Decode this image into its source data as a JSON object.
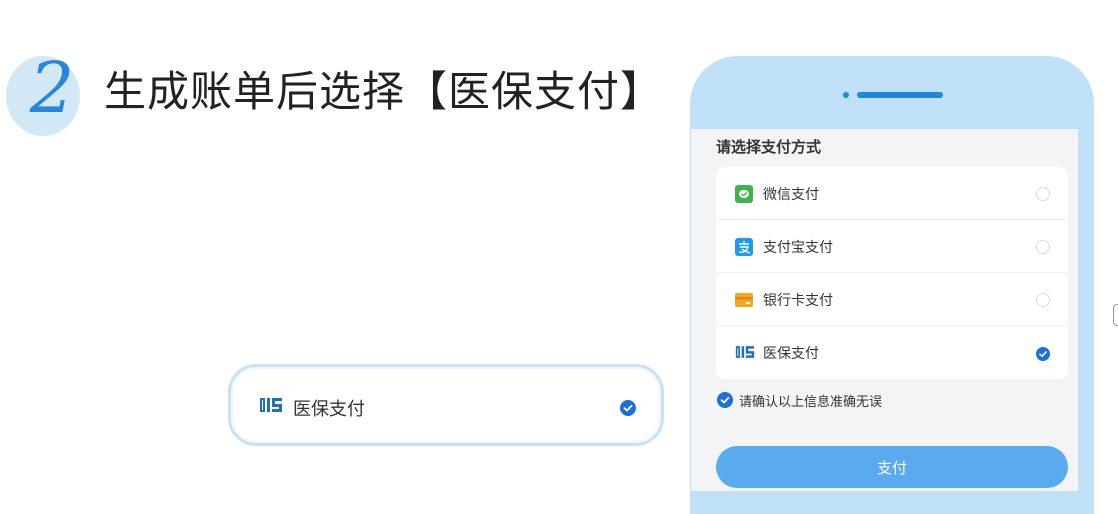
{
  "step": {
    "number": "2",
    "title": "生成账单后选择【医保支付】"
  },
  "callout": {
    "label": "医保支付",
    "selected": true
  },
  "phone": {
    "screen_title": "请选择支付方式",
    "options": [
      {
        "label": "微信支付",
        "icon": "wechat-pay-icon",
        "selected": false
      },
      {
        "label": "支付宝支付",
        "icon": "alipay-icon",
        "selected": false
      },
      {
        "label": "银行卡支付",
        "icon": "bank-card-icon",
        "selected": false
      },
      {
        "label": "医保支付",
        "icon": "medical-insurance-icon",
        "selected": true
      }
    ],
    "confirm_text": "请确认以上信息准确无误",
    "confirm_checked": true,
    "pay_button": "支付"
  },
  "colors": {
    "accent": "#2a86d8",
    "phone_frame": "#bfe0f7",
    "pay_button": "#5aaaf0",
    "wechat_green": "#3cb44b",
    "alipay_blue": "#1a9bf0",
    "bank_orange": "#f5a623"
  }
}
